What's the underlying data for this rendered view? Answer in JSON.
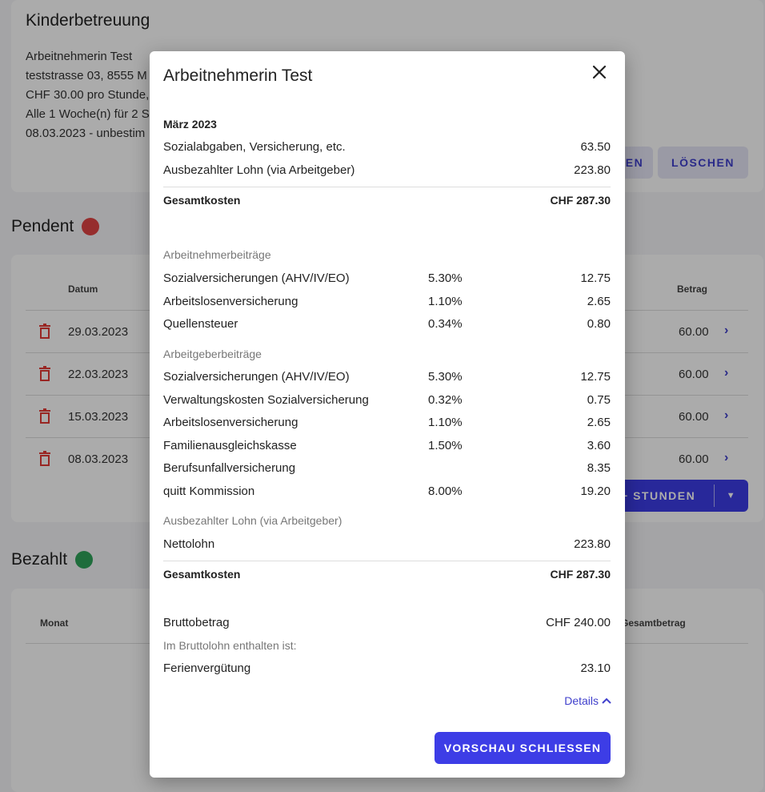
{
  "background": {
    "card_title": "Kinderbetreuung",
    "employee_link": "Arbeitnehmerin Test",
    "address": "teststrasse 03, 8555 M",
    "rate": "CHF 30.00 pro Stunde,",
    "schedule": "Alle 1 Woche(n) für 2 S",
    "period": "08.03.2023 - unbestim",
    "edit_button_fragment": "EN",
    "delete_button": "LÖSCHEN",
    "pendent_title": "Pendent",
    "pendent_dot_color": "#e04444",
    "pendent_headers": {
      "date": "Datum",
      "amount": "Betrag"
    },
    "pendent_rows": [
      {
        "date": "29.03.2023",
        "amount": "60.00"
      },
      {
        "date": "22.03.2023",
        "amount": "60.00"
      },
      {
        "date": "15.03.2023",
        "amount": "60.00"
      },
      {
        "date": "08.03.2023",
        "amount": "60.00"
      }
    ],
    "stunden_button": "+ STUNDEN",
    "bezahlt_title": "Bezahlt",
    "bezahlt_dot_color": "#2fa35a",
    "bezahlt_headers": {
      "month": "Monat",
      "total": "Gesamtbetrag"
    }
  },
  "modal": {
    "title": "Arbeitnehmerin Test",
    "month": "März 2023",
    "summary": [
      {
        "label": "Sozialabgaben, Versicherung, etc.",
        "value": "63.50"
      },
      {
        "label": "Ausbezahlter Lohn (via Arbeitgeber)",
        "value": "223.80"
      }
    ],
    "total_label": "Gesamtkosten",
    "total_value": "CHF 287.30",
    "employee_section": "Arbeitnehmerbeiträge",
    "employee_rows": [
      {
        "label": "Sozialversicherungen (AHV/IV/EO)",
        "pct": "5.30%",
        "value": "12.75"
      },
      {
        "label": "Arbeitslosenversicherung",
        "pct": "1.10%",
        "value": "2.65"
      },
      {
        "label": "Quellensteuer",
        "pct": "0.34%",
        "value": "0.80"
      }
    ],
    "employer_section": "Arbeitgeberbeiträge",
    "employer_rows": [
      {
        "label": "Sozialversicherungen (AHV/IV/EO)",
        "pct": "5.30%",
        "value": "12.75"
      },
      {
        "label": "Verwaltungskosten Sozialversicherung",
        "pct": "0.32%",
        "value": "0.75"
      },
      {
        "label": "Arbeitslosenversicherung",
        "pct": "1.10%",
        "value": "2.65"
      },
      {
        "label": "Familienausgleichskasse",
        "pct": "1.50%",
        "value": "3.60"
      },
      {
        "label": "Berufsunfallversicherung",
        "pct": "",
        "value": "8.35"
      },
      {
        "label": "quitt Kommission",
        "pct": "8.00%",
        "value": "19.20"
      }
    ],
    "payout_section": "Ausbezahlter Lohn (via Arbeitgeber)",
    "net_label": "Nettolohn",
    "net_value": "223.80",
    "total2_label": "Gesamtkosten",
    "total2_value": "CHF 287.30",
    "gross_label": "Bruttobetrag",
    "gross_value": "CHF 240.00",
    "included_note": "Im Bruttolohn enthalten ist:",
    "vacation_label": "Ferienvergütung",
    "vacation_value": "23.10",
    "details_link": "Details",
    "close_button": "VORSCHAU SCHLIESSEN",
    "accent_color": "#3d3de6"
  }
}
